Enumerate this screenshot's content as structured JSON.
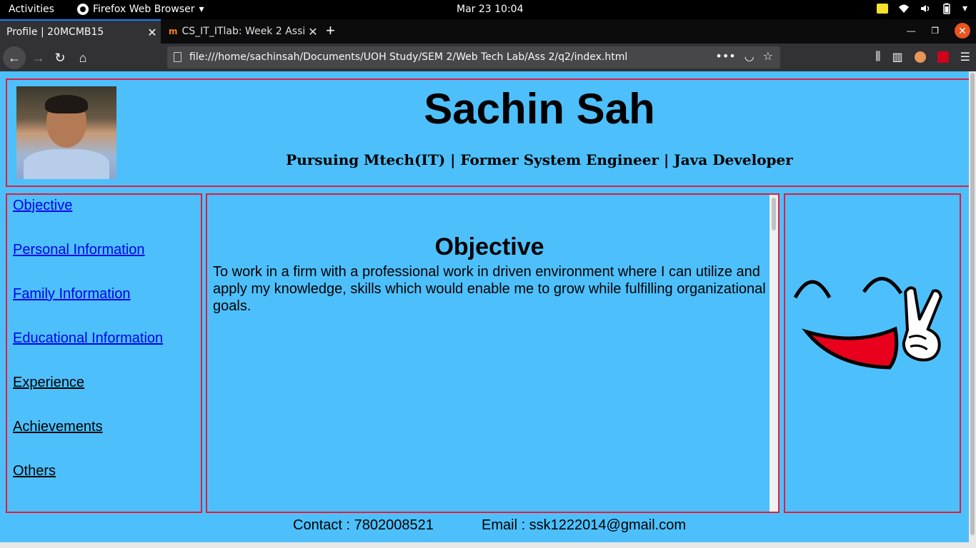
{
  "system_bar": {
    "activities": "Activities",
    "app_name": "Firefox Web Browser",
    "clock": "Mar 23  10:04",
    "icons": [
      "notes-icon",
      "wifi-icon",
      "volume-icon",
      "battery-icon",
      "power-menu-icon"
    ]
  },
  "browser": {
    "tabs": [
      {
        "title": "Profile | 20MCMB15",
        "active": true
      },
      {
        "title": "CS_IT_ITlab: Week 2 Assi",
        "active": false,
        "icon": "m"
      }
    ],
    "url": "file:///home/sachinsah/Documents/UOH Study/SEM 2/Web Tech Lab/Ass 2/q2/index.html",
    "accent": "#0a84ff",
    "close_color": "#e95420"
  },
  "page": {
    "background": "#4dc0fc",
    "border_color": "#e31c3d",
    "header": {
      "name": "Sachin Sah",
      "tagline": "Pursuing Mtech(IT) | Former System Engineer | Java Developer"
    },
    "sidebar": {
      "items": [
        {
          "label": "Objective",
          "style": "linked"
        },
        {
          "label": "Personal Information",
          "style": "linked"
        },
        {
          "label": "Family Information",
          "style": "linked"
        },
        {
          "label": "Educational Information",
          "style": "linked"
        },
        {
          "label": "Experience",
          "style": "plain"
        },
        {
          "label": "Achievements",
          "style": "plain"
        },
        {
          "label": "Others",
          "style": "plain"
        }
      ]
    },
    "main": {
      "heading": "Objective",
      "body": "To work in a firm with a professional work in driven environment where I can utilize and apply my knowledge, skills which would enable me to grow while fulfilling organizational goals."
    },
    "footer": {
      "contact": "Contact : 7802008521",
      "email": "Email : ssk1222014@gmail.com"
    }
  }
}
